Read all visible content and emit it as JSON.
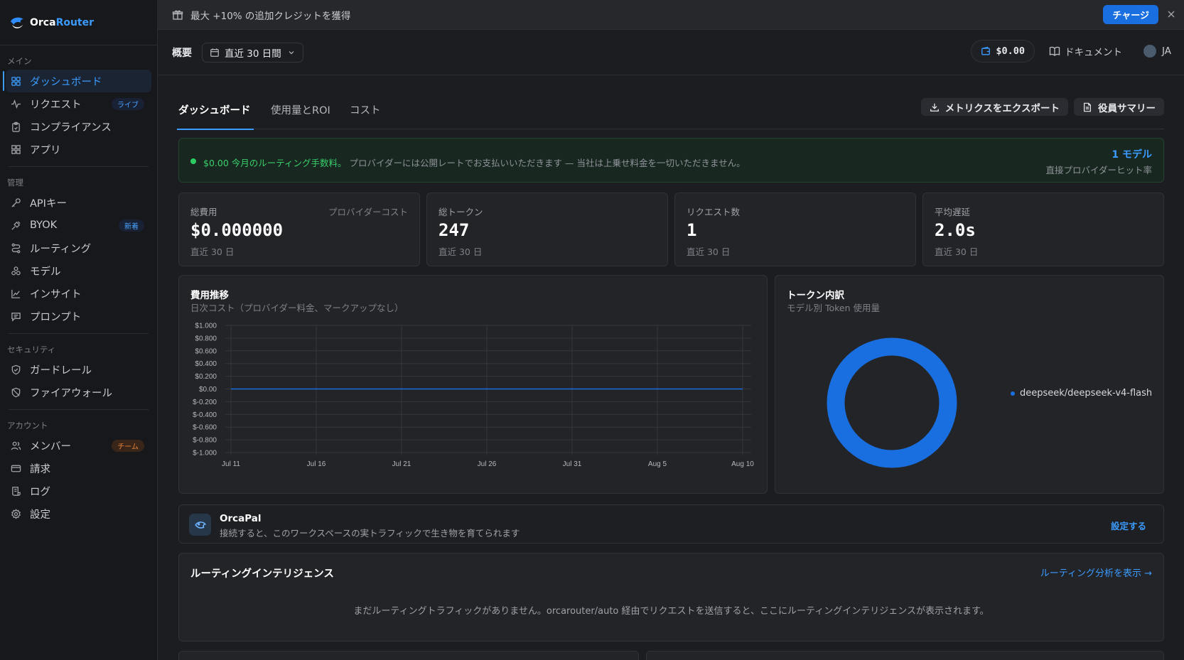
{
  "brand": {
    "name_part1": "Orca",
    "name_part2": "Router"
  },
  "sidebar": {
    "sections": [
      {
        "title": "メイン",
        "items": [
          {
            "label": "ダッシュボード",
            "icon": "dashboard-icon",
            "active": true
          },
          {
            "label": "リクエスト",
            "icon": "activity-icon",
            "badge": "ライブ"
          },
          {
            "label": "コンプライアンス",
            "icon": "clipboard-icon"
          },
          {
            "label": "アプリ",
            "icon": "apps-grid-icon"
          }
        ]
      },
      {
        "title": "管理",
        "items": [
          {
            "label": "APIキー",
            "icon": "key-icon"
          },
          {
            "label": "BYOK",
            "icon": "plug-icon",
            "badge": "新着"
          },
          {
            "label": "ルーティング",
            "icon": "route-icon"
          },
          {
            "label": "モデル",
            "icon": "models-icon"
          },
          {
            "label": "インサイト",
            "icon": "chart-line-icon"
          },
          {
            "label": "プロンプト",
            "icon": "message-icon"
          }
        ]
      },
      {
        "title": "セキュリティ",
        "items": [
          {
            "label": "ガードレール",
            "icon": "shield-check-icon"
          },
          {
            "label": "ファイアウォール",
            "icon": "shield-off-icon"
          }
        ]
      },
      {
        "title": "アカウント",
        "items": [
          {
            "label": "メンバー",
            "icon": "users-icon",
            "badge": "チーム"
          },
          {
            "label": "請求",
            "icon": "credit-card-icon"
          },
          {
            "label": "ログ",
            "icon": "logs-icon"
          },
          {
            "label": "設定",
            "icon": "gear-icon"
          }
        ]
      }
    ]
  },
  "banner": {
    "text": "最大 +10% の追加クレジットを獲得",
    "charge_label": "チャージ"
  },
  "header": {
    "crumb": "概要",
    "range_label": "直近 30 日間",
    "balance": "$0.00",
    "docs_label": "ドキュメント",
    "lang": "JA"
  },
  "tabs": [
    "ダッシュボード",
    "使用量とROI",
    "コスト"
  ],
  "tab_actions": {
    "export": "メトリクスをエクスポート",
    "summary": "役員サマリー"
  },
  "fee": {
    "highlight": "$0.00 今月のルーティング手数料。",
    "rest": "プロバイダーには公開レートでお支払いいただきます — 当社は上乗せ料金を一切いただきません。",
    "models": "1 モデル",
    "hit_rate": "直接プロバイダーヒット率"
  },
  "stats": [
    {
      "label": "総費用",
      "label_right": "プロバイダーコスト",
      "value": "$0.000000",
      "sub": "直近 30 日"
    },
    {
      "label": "総トークン",
      "value": "247",
      "sub": "直近 30 日"
    },
    {
      "label": "リクエスト数",
      "value": "1",
      "sub": "直近 30 日"
    },
    {
      "label": "平均遅延",
      "value": "2.0s",
      "sub": "直近 30 日"
    }
  ],
  "cost_panel": {
    "title": "費用推移",
    "subtitle": "日次コスト（プロバイダー料金、マークアップなし）"
  },
  "token_panel": {
    "title": "トークン内訳",
    "subtitle": "モデル別 Token 使用量"
  },
  "chart_data": [
    {
      "type": "line",
      "title": "費用推移",
      "subtitle": "日次コスト（プロバイダー料金、マークアップなし）",
      "x_ticks": [
        "Jul 11",
        "Jul 16",
        "Jul 21",
        "Jul 26",
        "Jul 31",
        "Aug 5",
        "Aug 10"
      ],
      "y_ticks": [
        "$1.000",
        "$0.800",
        "$0.600",
        "$0.400",
        "$0.200",
        "$0.00",
        "$-0.200",
        "$-0.400",
        "$-0.600",
        "$-0.800",
        "$-1.000"
      ],
      "ylim": [
        -1,
        1
      ],
      "grid": true,
      "series": [
        {
          "color": "#1a6fe0",
          "values": [
            0,
            0,
            0,
            0,
            0,
            0,
            0
          ]
        }
      ]
    },
    {
      "type": "pie",
      "title": "トークン内訳",
      "subtitle": "モデル別 Token 使用量",
      "donut": true,
      "legend_position": "right",
      "slices": [
        {
          "label": "deepseek/deepseek-v4-flash",
          "value": 247,
          "color": "#1a6fe0"
        }
      ]
    }
  ],
  "orcapal": {
    "title": "OrcaPal",
    "desc": "接続すると、このワークスペースの実トラフィックで生き物を育てられます",
    "setup": "設定する"
  },
  "routing": {
    "title": "ルーティングインテリジェンス",
    "link": "ルーティング分析を表示 →",
    "empty": "まだルーティングトラフィックがありません。orcarouter/auto 経由でリクエストを送信すると、ここにルーティングインテリジェンスが表示されます。"
  }
}
